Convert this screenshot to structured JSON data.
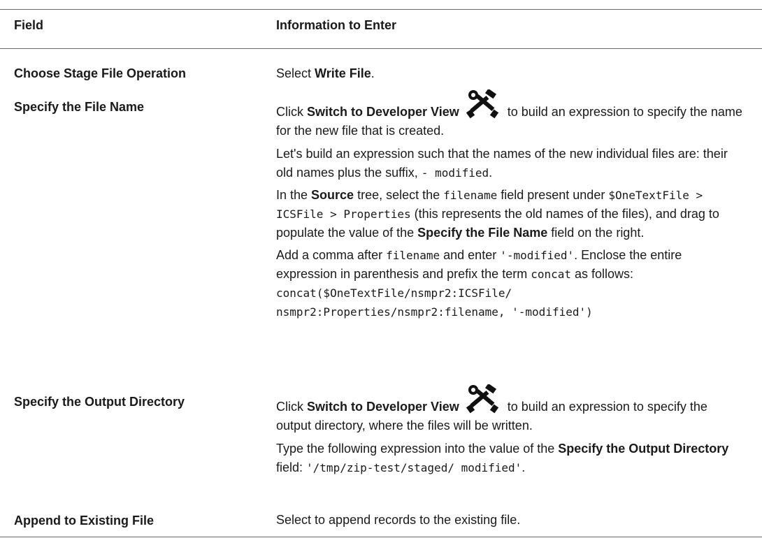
{
  "header": {
    "field": "Field",
    "info": "Information to Enter"
  },
  "rows": [
    {
      "label": "Choose Stage File Operation",
      "p1_a": "Select ",
      "p1_b": "Write File",
      "p1_c": "."
    },
    {
      "label": "Specify the File Name",
      "p1_a": "Click ",
      "p1_b": "Switch to Developer View",
      "p1_c": " to build an expression to specify the name for the new file that is created.",
      "p2_a": "Let's build an expression such that the names of the new individual files are: their old names plus the suffix, ",
      "p2_code": "- modified",
      "p2_c": ".",
      "p3_a": "In the ",
      "p3_b": "Source",
      "p3_c": " tree, select the ",
      "p3_code1": "filename",
      "p3_d": " field present under ",
      "p3_code2": "$OneTextFile > ICSFile > Properties",
      "p3_e": " (this represents the old names of the files), and drag to populate the value of the ",
      "p3_f": "Specify the File Name",
      "p3_g": " field on the right.",
      "p4_a": "Add a comma after ",
      "p4_code1": "filename",
      "p4_b": " and enter ",
      "p4_code2": "'-modified'",
      "p4_c": ". Enclose the entire expression in parenthesis and prefix the term ",
      "p4_code3": "concat",
      "p4_d": " as follows: ",
      "p4_code4": "concat($OneTextFile/nsmpr2:ICSFile/",
      "p4_code5": "nsmpr2:Properties/nsmpr2:filename, '-modified')"
    },
    {
      "label": "Specify the Output Directory",
      "p1_a": "Click ",
      "p1_b": "Switch to Developer View",
      "p1_c": " to build an expression to specify the output directory, where the files will be written.",
      "p2_a": "Type the following expression into the value of the ",
      "p2_b": "Specify the Output Directory",
      "p2_c": " field: ",
      "p2_code": "'/tmp/zip-test/staged/ modified'",
      "p2_d": "."
    },
    {
      "label": "Append to Existing File",
      "p1_a": "Select to append records to the existing file."
    }
  ],
  "icons": {
    "developer_view": "tools-icon"
  },
  "colors": {
    "text": "#1a1a1a",
    "rule": "#6b6b6b"
  }
}
